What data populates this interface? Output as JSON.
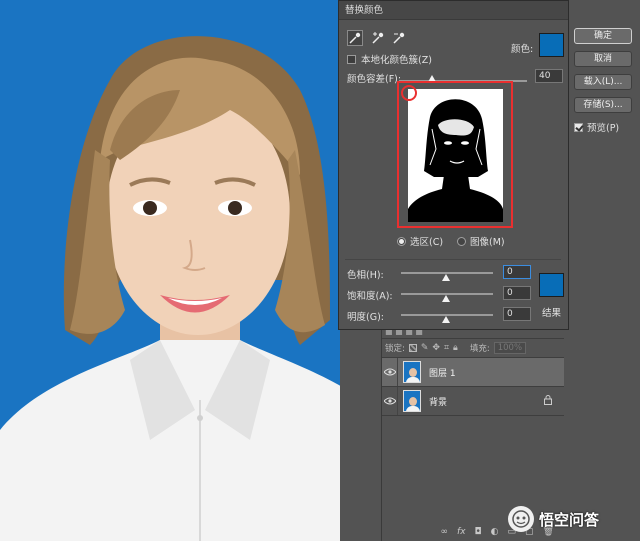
{
  "dialog": {
    "title": "替换颜色",
    "color_label": "颜色:",
    "local_color_clusters": "本地化颜色簇(Z)",
    "fuzziness_label": "颜色容差(F):",
    "fuzziness_value": "40",
    "radio_selection": "选区(C)",
    "radio_image": "图像(M)",
    "hue_label": "色相(H):",
    "hue_value": "0",
    "saturation_label": "饱和度(A):",
    "saturation_value": "0",
    "lightness_label": "明度(G):",
    "lightness_value": "0",
    "result_label": "结果",
    "color_hex": "#086db7",
    "result_hex": "#086db7"
  },
  "buttons": {
    "ok": "确定",
    "cancel": "取消",
    "load": "载入(L)...",
    "save": "存储(S)...",
    "preview": "预览(P)"
  },
  "layers": {
    "lock_label": "锁定:",
    "fill_label": "填充:",
    "fill_value": "100%",
    "items": [
      {
        "name": "图层 1",
        "selected": true
      },
      {
        "name": "背景",
        "selected": false
      }
    ],
    "bottom_icons": [
      "link-icon",
      "fx-icon",
      "mask-icon",
      "adjustment-icon",
      "folder-icon",
      "new-layer-icon",
      "trash-icon"
    ]
  },
  "watermark": {
    "text": "悟空问答"
  },
  "colors": {
    "photo_background": "#1a74c2",
    "panel": "#535353",
    "highlight_frame": "#ea2f2f"
  }
}
